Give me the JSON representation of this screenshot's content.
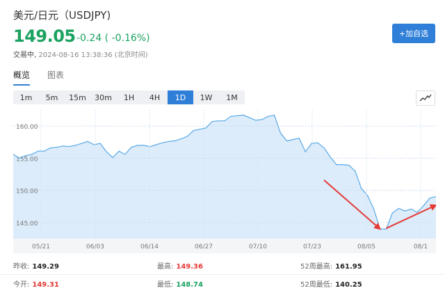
{
  "header": {
    "title": "美元/日元（USDJPY)",
    "price": "149.05",
    "change": "-0.24 ( -0.16%)",
    "status_label": "交易中,",
    "datetime": "2024-08-16 13:38:36",
    "timezone": "(北京时间)",
    "add_button": "+加自选"
  },
  "tabs": [
    {
      "label": "概览",
      "active": true
    },
    {
      "label": "图表",
      "active": false
    }
  ],
  "ranges": [
    {
      "label": "1m",
      "active": false
    },
    {
      "label": "5m",
      "active": false
    },
    {
      "label": "15m",
      "active": false
    },
    {
      "label": "30m",
      "active": false
    },
    {
      "label": "1H",
      "active": false
    },
    {
      "label": "4H",
      "active": false
    },
    {
      "label": "1D",
      "active": true
    },
    {
      "label": "1W",
      "active": false
    },
    {
      "label": "1M",
      "active": false
    }
  ],
  "chart_icon": "line-chart-icon",
  "colors": {
    "accent": "#2f7fd8",
    "down": "#1aa260",
    "up": "#e53935",
    "area_fill": "#dcecfb",
    "line": "#5aa9e6",
    "arrow": "#e53935"
  },
  "chart_data": {
    "type": "area",
    "title": "",
    "xlabel": "",
    "ylabel": "",
    "ylim": [
      142.5,
      162.5
    ],
    "yticks": [
      "160.00",
      "155.00",
      "150.00",
      "145.00"
    ],
    "xticks": [
      "05/21",
      "06/03",
      "06/14",
      "06/27",
      "07/10",
      "07/23",
      "08/05",
      "08/1"
    ],
    "values": [
      155.6,
      155.0,
      155.4,
      155.6,
      156.1,
      156.1,
      156.6,
      156.7,
      156.9,
      156.8,
      157.0,
      157.3,
      157.6,
      157.1,
      157.3,
      156.0,
      155.1,
      156.1,
      155.6,
      156.7,
      157.0,
      157.0,
      156.8,
      157.1,
      157.4,
      157.6,
      157.7,
      158.0,
      158.4,
      159.3,
      159.5,
      159.7,
      160.7,
      160.8,
      160.8,
      161.5,
      161.6,
      161.7,
      161.3,
      160.9,
      161.0,
      161.5,
      161.7,
      158.9,
      157.7,
      157.9,
      158.1,
      156.0,
      157.3,
      157.4,
      156.6,
      155.2,
      154.0,
      154.0,
      153.9,
      153.0,
      150.3,
      149.2,
      147.1,
      144.0,
      144.0,
      146.5,
      147.2,
      146.8,
      147.1,
      146.6,
      147.6,
      148.8,
      149.05
    ],
    "annotations": [
      {
        "type": "arrow",
        "from_index": 50,
        "to_index": 59,
        "from_value": 151.6,
        "to_value": 144.0
      },
      {
        "type": "arrow",
        "from_index": 60,
        "to_index": 68,
        "from_value": 144.1,
        "to_value": 147.7
      }
    ]
  },
  "stats": {
    "prev_close_label": "昨收:",
    "prev_close": "149.29",
    "open_label": "今开:",
    "open": "149.31",
    "high_label": "最高:",
    "high": "149.36",
    "low_label": "最低:",
    "low": "148.74",
    "wk52_high_label": "52周最高:",
    "wk52_high": "161.95",
    "wk52_low_label": "52周最低:",
    "wk52_low": "140.25"
  }
}
